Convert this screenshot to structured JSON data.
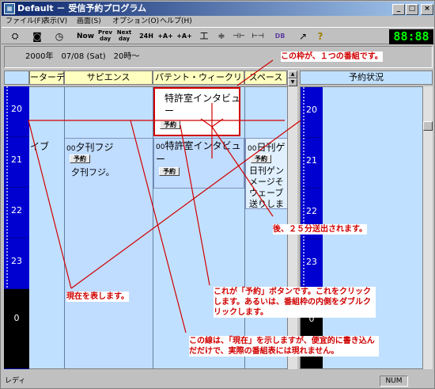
{
  "window": {
    "title": "Default － 受信予約プログラム",
    "buttons": [
      "_",
      "□",
      "×"
    ]
  },
  "menu": [
    "ファイル(F)",
    "表示(V)",
    "画面(S)",
    "オプション(O)",
    "ヘルプ(H)"
  ],
  "toolbar": {
    "buttons": [
      {
        "icon": "tool-icon",
        "label": "⛭"
      },
      {
        "icon": "refresh-icon",
        "label": "◙"
      },
      {
        "icon": "clock-icon",
        "label": "◷"
      },
      {
        "icon": "now-icon",
        "label": "Now"
      },
      {
        "icon": "prev-day-icon",
        "label": "Prev day"
      },
      {
        "icon": "next-day-icon",
        "label": "Next day"
      },
      {
        "icon": "24h-icon",
        "label": "24H"
      },
      {
        "icon": "font-smaller-icon",
        "label": "+A+"
      },
      {
        "icon": "font-larger-icon",
        "label": "+A+"
      },
      {
        "icon": "height-up-icon",
        "label": "工"
      },
      {
        "icon": "height-down-icon",
        "label": "≑"
      },
      {
        "icon": "width-up-icon",
        "label": "⊣⊢"
      },
      {
        "icon": "width-down-icon",
        "label": "⊢⊣"
      },
      {
        "icon": "database-icon",
        "label": "DB"
      },
      {
        "icon": "export-icon",
        "label": "↗"
      },
      {
        "icon": "help-icon",
        "label": "?"
      }
    ],
    "clock": "88:88"
  },
  "date_bar": "2000年　07/08 (Sat)　20時〜",
  "channels": [
    "ーターデー",
    "サピエンス",
    "パテント・ウィークリ",
    "スペース"
  ],
  "reservation_status_header": "予約状況",
  "hours": [
    "20",
    "21",
    "22",
    "23",
    "0"
  ],
  "programs": {
    "patent1_title": "特許室インタビュー",
    "patent2_title": "特許室インタビュー",
    "patent2_time": "00",
    "evening_title": "夕刊フジ",
    "evening_time": "00",
    "evening_desc": "夕刊フジ。",
    "nikkan_title": "日刊ゲ",
    "nikkan_time": "00",
    "nikkan_desc": "日刊ゲンメージそウェーブ送りしま",
    "left_partial": "イブ",
    "reserve_label": "予約"
  },
  "annotations": {
    "a1": "この枠が、１つの番組です。",
    "a2": "後、２５分送出されます。",
    "a3": "現在を表します。",
    "a4": "これが「予約」ボタンです。これをクリックします。あるいは、番組枠の内側をダブルクリックします。",
    "a5": "この線は、「現在」を示しますが、便宜的に書き込んだだけで、実際の番組表には現れません。"
  },
  "status": {
    "left": "レディ",
    "num": "NUM"
  }
}
